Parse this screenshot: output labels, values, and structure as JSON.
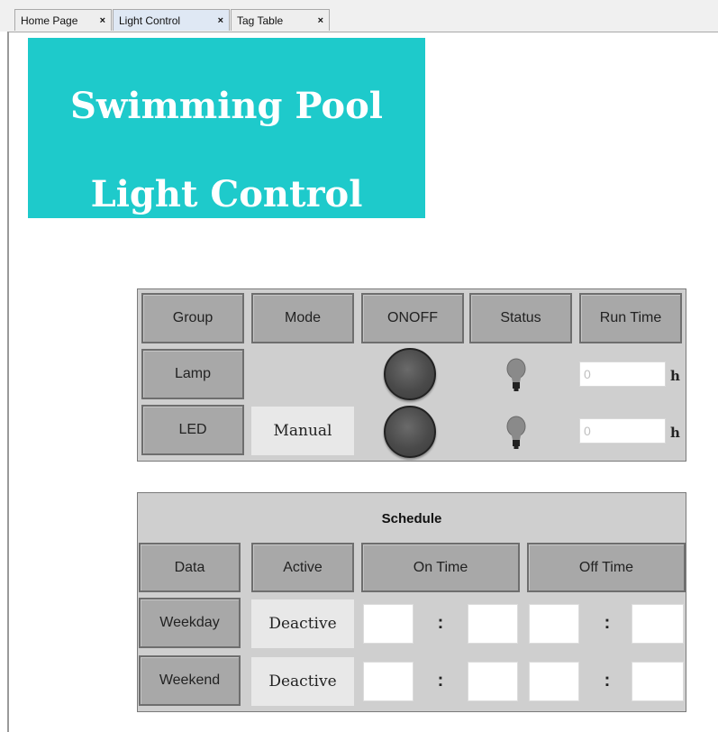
{
  "tabs": [
    {
      "label": "Home Page",
      "close": "×"
    },
    {
      "label": "Light Control",
      "close": "×"
    },
    {
      "label": "Tag Table",
      "close": "×"
    }
  ],
  "title": {
    "line1": "Swimming Pool",
    "line2": "Light Control"
  },
  "control": {
    "headers": {
      "group": "Group",
      "mode": "Mode",
      "onoff": "ONOFF",
      "status": "Status",
      "runtime": "Run Time"
    },
    "rows": [
      {
        "group": "Lamp",
        "mode": "",
        "runtime": "0",
        "unit": "h"
      },
      {
        "group": "LED",
        "mode": "Manual",
        "runtime": "0",
        "unit": "h"
      }
    ]
  },
  "schedule": {
    "title": "Schedule",
    "headers": {
      "data": "Data",
      "active": "Active",
      "on_time": "On Time",
      "off_time": "Off Time"
    },
    "separator": ":",
    "rows": [
      {
        "day": "Weekday",
        "active": "Deactive"
      },
      {
        "day": "Weekend",
        "active": "Deactive"
      }
    ]
  },
  "colors": {
    "title_bg": "#1ecacb",
    "panel_bg": "#cfcfcf",
    "button_bg": "#a8a8a8"
  }
}
